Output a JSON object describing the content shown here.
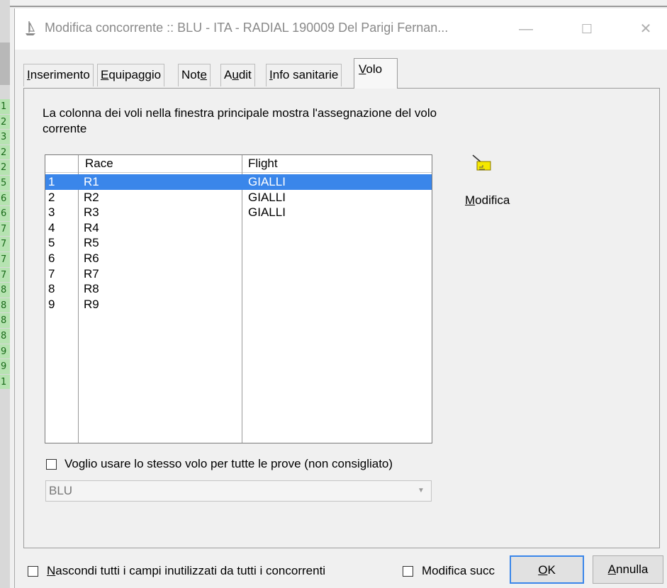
{
  "background_app": {
    "row_numbers": [
      "1",
      "2",
      "3",
      "2",
      "2",
      "5",
      "6",
      "6",
      "7",
      "7",
      "7",
      "7",
      "8",
      "8",
      "8",
      "8",
      "9",
      "9",
      "1"
    ]
  },
  "window": {
    "title": "Modifica concorrente :: BLU - ITA - RADIAL 190009 Del Parigi Fernan...",
    "minimize": "—",
    "maximize": "☐",
    "close": "✕"
  },
  "tabs": [
    {
      "label": "Inserimento",
      "access": "I"
    },
    {
      "label": "Equipaggio",
      "access": "E"
    },
    {
      "label": "Note",
      "access": "e"
    },
    {
      "label": "Audit",
      "access": "u"
    },
    {
      "label": "Info sanitarie",
      "access": "I"
    },
    {
      "label": "Volo",
      "access": "V",
      "active": true
    }
  ],
  "volo": {
    "description": "La colonna dei voli nella finestra principale mostra l'assegnazione del volo corrente",
    "list": {
      "headers": {
        "num": "",
        "race": "Race",
        "flight": "Flight"
      },
      "rows": [
        {
          "num": "1",
          "race": "R1",
          "flight": "GIALLI",
          "selected": true
        },
        {
          "num": "2",
          "race": "R2",
          "flight": "GIALLI"
        },
        {
          "num": "3",
          "race": "R3",
          "flight": "GIALLI"
        },
        {
          "num": "4",
          "race": "R4",
          "flight": ""
        },
        {
          "num": "5",
          "race": "R5",
          "flight": ""
        },
        {
          "num": "6",
          "race": "R6",
          "flight": ""
        },
        {
          "num": "7",
          "race": "R7",
          "flight": ""
        },
        {
          "num": "8",
          "race": "R8",
          "flight": ""
        },
        {
          "num": "9",
          "race": "R9",
          "flight": ""
        }
      ]
    },
    "modifica_button": "Modifica",
    "same_flight_checkbox": {
      "label": "Voglio usare lo stesso volo per tutte le prove (non consigliato)",
      "checked": false
    },
    "flight_combo": {
      "value": "BLU",
      "enabled": false
    }
  },
  "footer": {
    "hide_fields_checkbox": {
      "label": "Nascondi tutti i campi inutilizzati da tutti i concorrenti",
      "checked": false
    },
    "modifica_succ_checkbox": {
      "label": "Modifica succ",
      "checked": false
    },
    "ok_button": "OK",
    "annulla_button": "Annulla"
  },
  "colors": {
    "selection": "#3a86ea",
    "green_cells": "#b6e3b1"
  }
}
